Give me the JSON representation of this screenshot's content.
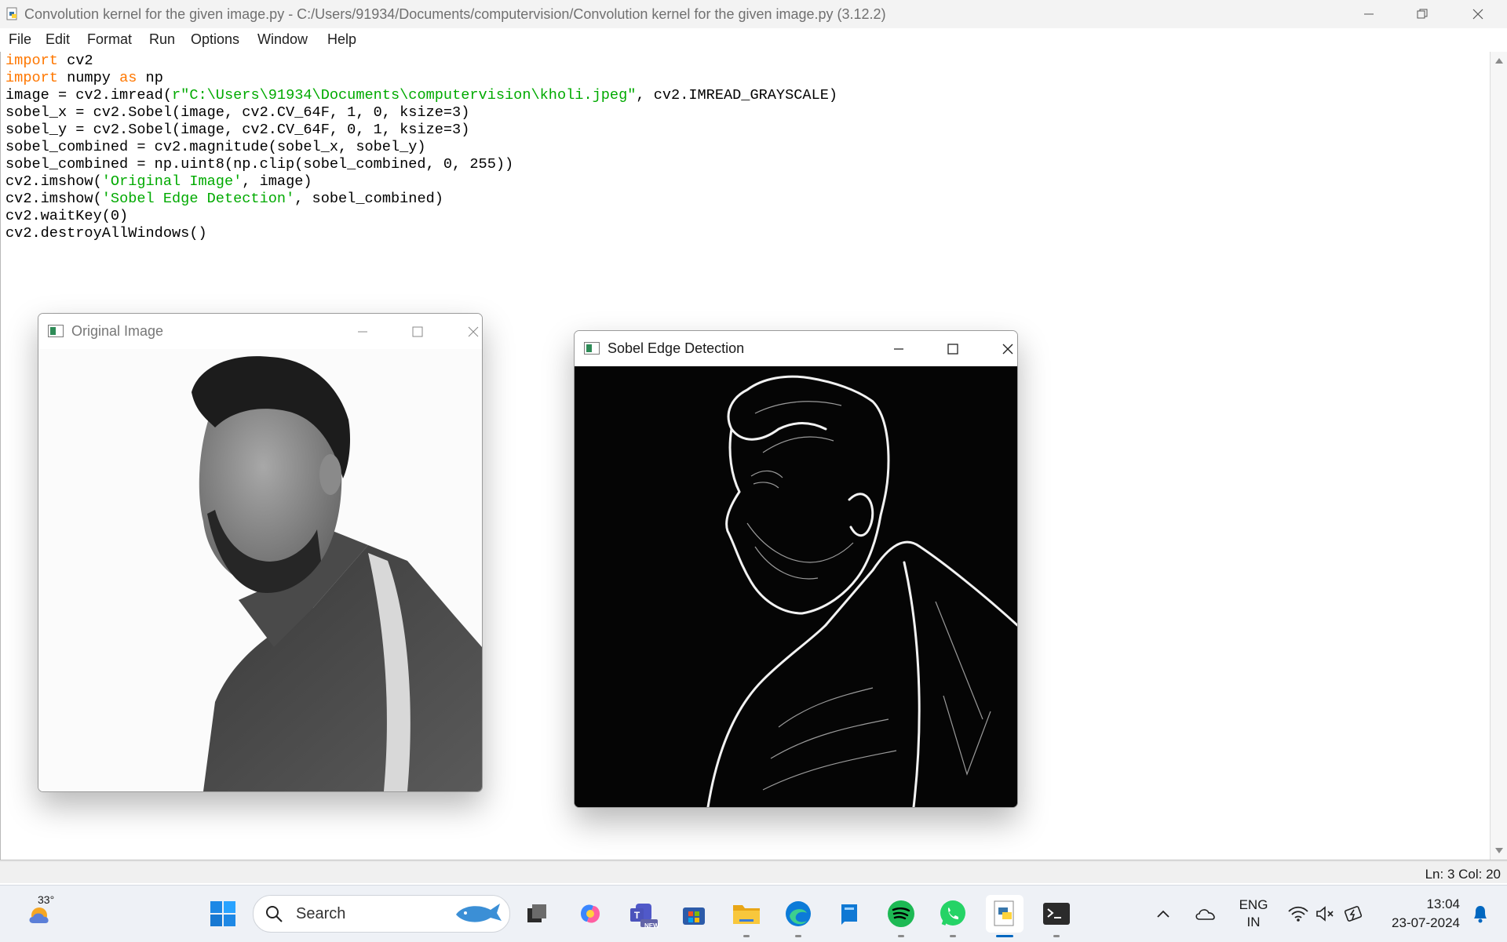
{
  "titlebar": {
    "title": "Convolution kernel for the given image.py - C:/Users/91934/Documents/computervision/Convolution kernel for the given image.py (3.12.2)"
  },
  "menu": [
    "File",
    "Edit",
    "Format",
    "Run",
    "Options",
    "Window",
    "Help"
  ],
  "code": {
    "l1_kw": "import",
    "l1_rest": " cv2",
    "l2_kw": "import",
    "l2_mid": " numpy ",
    "l2_kw2": "as",
    "l2_rest": " np",
    "l3_a": "image = cv2.imread(",
    "l3_str": "r\"C:\\Users\\91934\\Documents\\computervision\\kholi.jpeg\"",
    "l3_b": ", cv2.IMREAD_GRAYSCALE)",
    "l4": "sobel_x = cv2.Sobel(image, cv2.CV_64F, 1, 0, ksize=3)",
    "l5": "sobel_y = cv2.Sobel(image, cv2.CV_64F, 0, 1, ksize=3)",
    "l6": "sobel_combined = cv2.magnitude(sobel_x, sobel_y)",
    "l7": "sobel_combined = np.uint8(np.clip(sobel_combined, 0, 255))",
    "l8_a": "cv2.imshow(",
    "l8_str": "'Original Image'",
    "l8_b": ", image)",
    "l9_a": "cv2.imshow(",
    "l9_str": "'Sobel Edge Detection'",
    "l9_b": ", sobel_combined)",
    "l10": "cv2.waitKey(0)",
    "l11": "cv2.destroyAllWindows()"
  },
  "status": {
    "text": "Ln: 3   Col: 20"
  },
  "windows": {
    "original": {
      "title": "Original Image"
    },
    "sobel": {
      "title": "Sobel Edge Detection"
    }
  },
  "taskbar": {
    "weather_temp": "33°",
    "search_placeholder": "Search",
    "teams_badge": "NEW",
    "lang_top": "ENG",
    "lang_bottom": "IN",
    "time": "13:04",
    "date": "23-07-2024"
  },
  "colors": {
    "keyword": "#ff7700",
    "string": "#00aa00",
    "accent": "#0067c0"
  }
}
